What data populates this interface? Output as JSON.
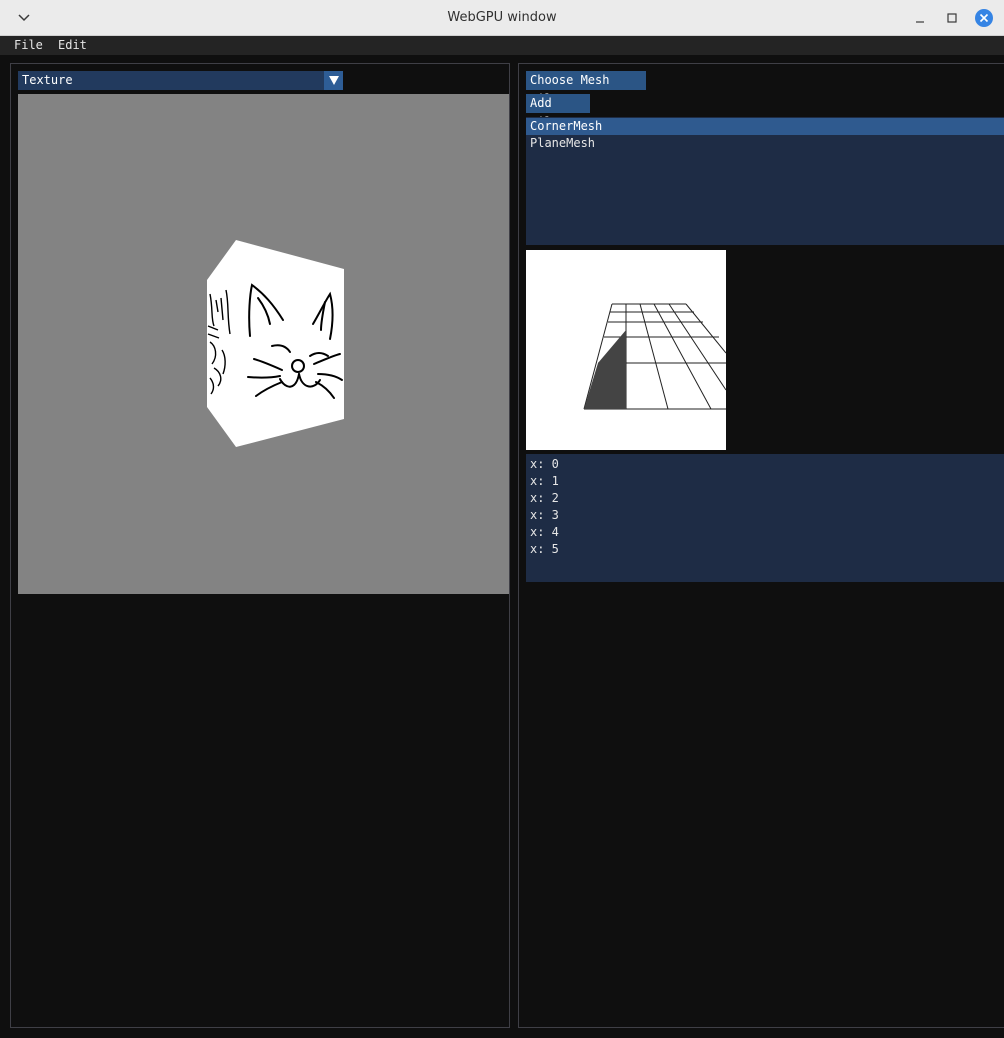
{
  "window": {
    "title": "WebGPU window",
    "menu_icon": "chevron-down-icon",
    "minimize_icon": "minimize-icon",
    "maximize_icon": "maximize-icon",
    "close_icon": "close-icon",
    "close_color": "#3584e4"
  },
  "menubar": {
    "items": [
      {
        "label": "File"
      },
      {
        "label": "Edit"
      }
    ]
  },
  "left_panel": {
    "dropdown": {
      "selected": "Texture",
      "arrow_icon": "triangle-down-icon"
    },
    "viewport": {
      "background": "#838383",
      "object": "cube with cat face texture"
    }
  },
  "right_panel": {
    "choose_mesh_button": "Choose Mesh File",
    "add_tile_button": "Add Tile",
    "mesh_list": [
      {
        "label": "CornerMesh",
        "selected": true
      },
      {
        "label": "PlaneMesh",
        "selected": false
      }
    ],
    "tile_list": [
      {
        "label": "x: 0"
      },
      {
        "label": "x: 1"
      },
      {
        "label": "x: 2"
      },
      {
        "label": "x: 3"
      },
      {
        "label": "x: 4"
      },
      {
        "label": "x: 5"
      }
    ]
  },
  "colors": {
    "accent": "#2b5585",
    "selection": "#2f5a8f",
    "list_bg": "#1e2c45",
    "panel_bg": "#0f0f0f"
  }
}
